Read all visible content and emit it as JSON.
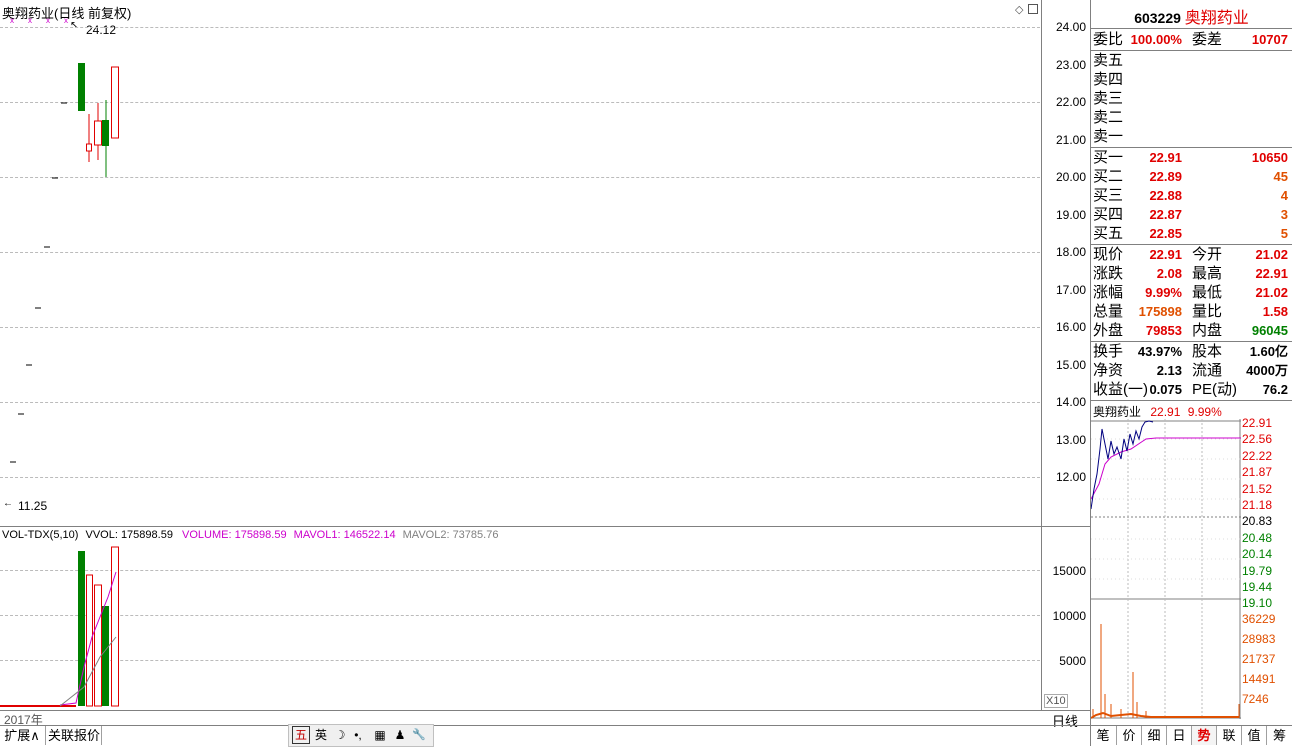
{
  "chart_title": "奥翔药业(日线 前复权)",
  "high_mark": "24.12",
  "low_mark": "11.25",
  "price_axis": [
    "24.00",
    "23.00",
    "22.00",
    "21.00",
    "20.00",
    "19.00",
    "18.00",
    "17.00",
    "16.00",
    "15.00",
    "14.00",
    "13.00",
    "12.00"
  ],
  "volume_legend": {
    "name": "VOL-TDX(5,10)",
    "vvol": "VVOL: 175898.59",
    "volume": "VOLUME: 175898.59",
    "mavol1": "MAVOL1: 146522.14",
    "mavol2": "MAVOL2: 73785.76"
  },
  "volume_axis": [
    "15000",
    "10000",
    "5000"
  ],
  "volume_unit": "X10",
  "date_label": "2017年",
  "period_label": "日线",
  "bottom_tabs": [
    "扩展∧",
    "关联报价"
  ],
  "ime_bar": [
    "五",
    "英",
    "☽",
    "•,",
    "▦",
    "♟",
    "🔧"
  ],
  "stock": {
    "code": "603229",
    "name": "奥翔药业"
  },
  "order_ratio": {
    "label1": "委比",
    "val1": "100.00%",
    "label2": "委差",
    "val2": "10707"
  },
  "sell_levels": [
    "卖五",
    "卖四",
    "卖三",
    "卖二",
    "卖一"
  ],
  "buy_levels": [
    {
      "label": "买一",
      "price": "22.91",
      "vol": "10650"
    },
    {
      "label": "买二",
      "price": "22.89",
      "vol": "45"
    },
    {
      "label": "买三",
      "price": "22.88",
      "vol": "4"
    },
    {
      "label": "买四",
      "price": "22.87",
      "vol": "3"
    },
    {
      "label": "买五",
      "price": "22.85",
      "vol": "5"
    }
  ],
  "quote": [
    {
      "l1": "现价",
      "v1": "22.91",
      "l2": "今开",
      "v2": "21.02"
    },
    {
      "l1": "涨跌",
      "v1": "2.08",
      "l2": "最高",
      "v2": "22.91"
    },
    {
      "l1": "涨幅",
      "v1": "9.99%",
      "l2": "最低",
      "v2": "21.02"
    },
    {
      "l1": "总量",
      "v1": "175898",
      "l2": "量比",
      "v2": "1.58"
    },
    {
      "l1": "外盘",
      "v1": "79853",
      "l2": "内盘",
      "v2": "96045"
    }
  ],
  "fundamentals": [
    {
      "l1": "换手",
      "v1": "43.97%",
      "l2": "股本",
      "v2": "1.60亿"
    },
    {
      "l1": "净资",
      "v1": "2.13",
      "l2": "流通",
      "v2": "4000万"
    },
    {
      "l1": "收益(一)",
      "v1": "0.075",
      "l2": "PE(动)",
      "v2": "76.2"
    }
  ],
  "mini_chart": {
    "name": "奥翔药业",
    "price": "22.91",
    "pct": "9.99%",
    "price_ticks": [
      "22.91",
      "22.56",
      "22.22",
      "21.87",
      "21.52",
      "21.18",
      "20.83",
      "20.48",
      "20.14",
      "19.79",
      "19.44",
      "19.10"
    ],
    "vol_ticks": [
      "36229",
      "28983",
      "21737",
      "14491",
      "7246"
    ]
  },
  "right_tabs": [
    "笔",
    "价",
    "细",
    "日",
    "势",
    "联",
    "值",
    "筹"
  ],
  "colors": {
    "up": "#e00000",
    "down": "#008000",
    "ma1": "#cc00cc",
    "axis": "#808080"
  },
  "chart_data": {
    "type": "candlestick",
    "title": "奥翔药业(日线 前复权)",
    "ohlc_visible_candles": [
      {
        "open": 22.8,
        "close": 21.75,
        "high": 22.8,
        "low": 21.75
      },
      {
        "open": 20.4,
        "close": 20.2,
        "high": 21.6,
        "low": 20.0
      },
      {
        "open": 20.4,
        "close": 21.3,
        "high": 21.9,
        "low": 20.1
      },
      {
        "open": 21.3,
        "close": 20.6,
        "high": 22.0,
        "low": 20.0
      },
      {
        "open": 21.0,
        "close": 22.91,
        "high": 22.91,
        "low": 21.0
      }
    ],
    "ipo_limit_up_dashes": [
      22.0,
      20.0,
      18.0,
      16.5,
      15.0,
      13.7,
      12.4
    ],
    "volume_bars": [
      {
        "value": 17500,
        "color": "down"
      },
      {
        "value": 14500,
        "color": "up"
      },
      {
        "value": 13500,
        "color": "up"
      },
      {
        "value": 11000,
        "color": "down"
      },
      {
        "value": 17600,
        "color": "up"
      }
    ],
    "ylim": [
      11.25,
      24.12
    ],
    "volume_ylim": [
      0,
      19000
    ]
  }
}
